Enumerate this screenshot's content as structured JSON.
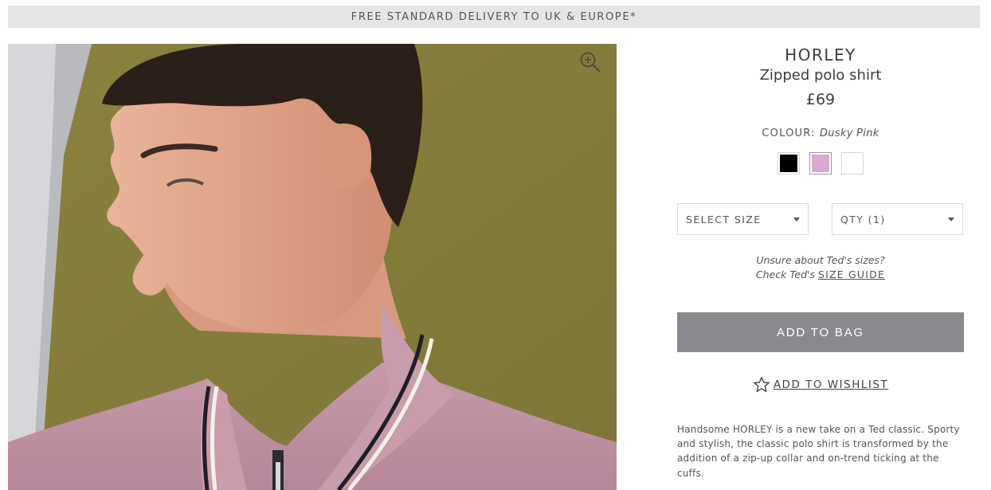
{
  "promo": {
    "text": "FREE STANDARD DELIVERY TO UK & EUROPE*"
  },
  "product": {
    "brand": "HORLEY",
    "subtitle": "Zipped polo shirt",
    "price": "£69",
    "colour_label": "COLOUR:",
    "colour_value": "Dusky Pink",
    "swatches": [
      {
        "name": "Black",
        "color": "#000000"
      },
      {
        "name": "Dusky Pink",
        "color": "#d9a9d2",
        "selected": true
      },
      {
        "name": "White",
        "color": "#ffffff"
      }
    ],
    "size_select": {
      "value": "SELECT SIZE"
    },
    "qty_select": {
      "value": "QTY (1)"
    },
    "size_help": {
      "line1": "Unsure about Ted's sizes?",
      "line2_prefix": "Check Ted's",
      "link": "SIZE GUIDE"
    },
    "add_to_bag": "ADD TO BAG",
    "add_to_wishlist": "ADD TO WISHLIST",
    "description": "Handsome HORLEY is a new take on a Ted classic. Sporty and stylish, the classic polo shirt is transformed by the addition of a zip-up collar and on-trend ticking at the cuffs."
  },
  "icons": {
    "zoom": "zoom-in-icon",
    "wishlist": "star-icon"
  },
  "colors": {
    "button_bg": "#898a8e",
    "promo_bg": "#e4e5e5",
    "backdrop": "#8d8340",
    "shirt": "#c9a0aa"
  }
}
